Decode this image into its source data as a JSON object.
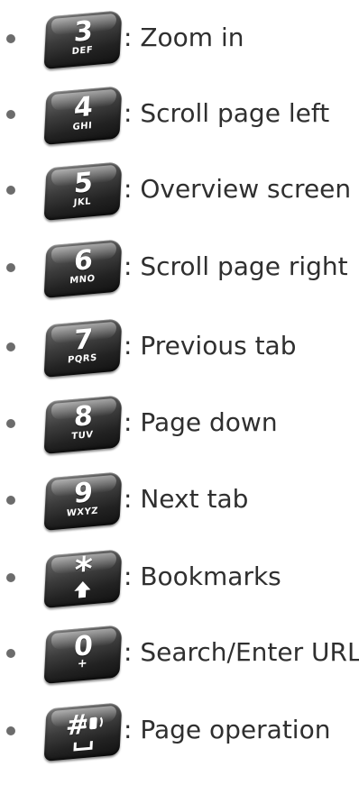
{
  "items": [
    {
      "key": "3",
      "letters": "DEF",
      "label": ": Zoom in"
    },
    {
      "key": "4",
      "letters": "GHI",
      "label": ": Scroll page left"
    },
    {
      "key": "5",
      "letters": "JKL",
      "label": ": Overview screen"
    },
    {
      "key": "6",
      "letters": "MNO",
      "label": ": Scroll page right"
    },
    {
      "key": "7",
      "letters": "PQRS",
      "label": ": Previous tab"
    },
    {
      "key": "8",
      "letters": "TUV",
      "label": ": Page down"
    },
    {
      "key": "9",
      "letters": "WXYZ",
      "label": ": Next tab"
    },
    {
      "key": "*",
      "letters": "",
      "label": ": Bookmarks"
    },
    {
      "key": "0",
      "letters": "+",
      "label": ": Search/Enter URL"
    },
    {
      "key": "#",
      "letters": "",
      "label": ": Page operation"
    }
  ],
  "colors": {
    "bullet": "#6c6c6c",
    "key_face": "#2a2a2a",
    "key_text": "#ffffff",
    "label_text": "#2f2f2f"
  }
}
